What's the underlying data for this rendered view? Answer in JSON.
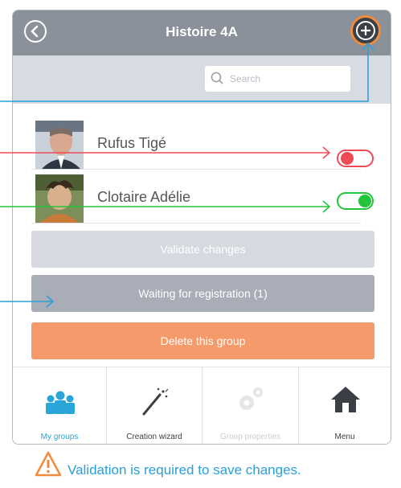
{
  "header": {
    "title": "Histoire 4A"
  },
  "search": {
    "placeholder": "Search"
  },
  "members": [
    {
      "name": "Rufus Tigé",
      "active": false
    },
    {
      "name": "Clotaire Adélie",
      "active": true
    }
  ],
  "actions": {
    "validate_label": "Validate changes",
    "waiting_label": "Waiting for registration (1)",
    "delete_label": "Delete this group"
  },
  "tabs": [
    {
      "label": "My groups",
      "icon": "people-icon"
    },
    {
      "label": "Creation wizard",
      "icon": "magic-wand-icon"
    },
    {
      "label": "Group properties",
      "icon": "gears-icon"
    },
    {
      "label": "Menu",
      "icon": "home-icon"
    }
  ],
  "note": {
    "text": "Validation is required to save changes.",
    "icon": "warning-icon"
  },
  "colors": {
    "header": "#8b919b",
    "accent_orange": "#f08a3c",
    "toggle_off": "#f04b55",
    "toggle_on": "#22c53a",
    "validate_btn": "#d6d9df",
    "waiting_btn": "#a8adb8",
    "delete_btn": "#f59a6b",
    "callout_blue": "#2a9fd6"
  }
}
